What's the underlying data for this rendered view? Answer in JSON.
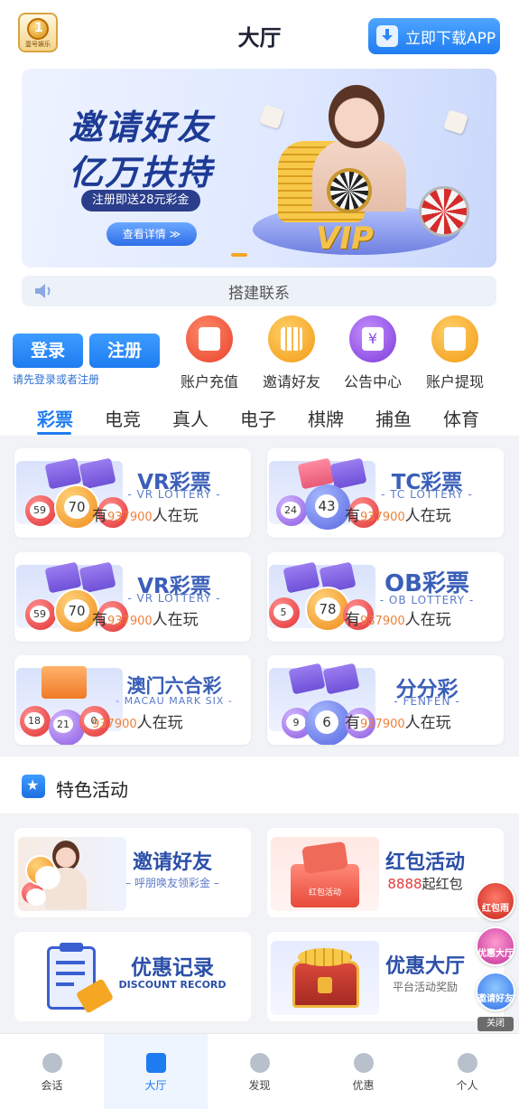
{
  "header": {
    "logo_text": "壹号娱乐",
    "title": "大厅",
    "download_label": "立即下载APP"
  },
  "banner": {
    "headline1": "邀请好友",
    "headline2": "亿万扶持",
    "subline": "注册即送28元彩金",
    "detail_label": "查看详情 ≫",
    "vip_text": "VIP"
  },
  "notice": {
    "text": "搭建联系"
  },
  "auth": {
    "login_label": "登录",
    "register_label": "注册",
    "hint": "请先登录或者注册"
  },
  "quick_actions": [
    {
      "label": "账户充值",
      "icon": "recharge-icon",
      "color": "#f0543c"
    },
    {
      "label": "邀请好友",
      "icon": "qrcode-icon",
      "color": "#f5a623"
    },
    {
      "label": "公告中心",
      "icon": "notice-icon",
      "color": "#8a4fe0"
    },
    {
      "label": "账户提现",
      "icon": "withdraw-icon",
      "color": "#f5a623"
    }
  ],
  "tabs": [
    "彩票",
    "电竞",
    "真人",
    "电子",
    "棋牌",
    "捕鱼",
    "体育"
  ],
  "active_tab": "彩票",
  "games": [
    {
      "title": "VR彩票",
      "subtitle": "- VR LOTTERY -",
      "play_prefix": "有",
      "players": "937900",
      "play_suffix": "人在玩",
      "ball": "70"
    },
    {
      "title": "TC彩票",
      "subtitle": "- TC LOTTERY -",
      "play_prefix": "有",
      "players": "937900",
      "play_suffix": "人在玩",
      "ball": "43"
    },
    {
      "title": "VR彩票",
      "subtitle": "- VR LOTTERY -",
      "play_prefix": "有",
      "players": "937900",
      "play_suffix": "人在玩",
      "ball": "70"
    },
    {
      "title": "OB彩票",
      "subtitle": "- OB LOTTERY -",
      "play_prefix": "有",
      "players": "937900",
      "play_suffix": "人在玩",
      "ball": "78"
    },
    {
      "title": "澳门六合彩",
      "subtitle": "- MACAU MARK SIX -",
      "play_prefix": "有",
      "players": "937900",
      "play_suffix": "人在玩",
      "ball": "21"
    },
    {
      "title": "分分彩",
      "subtitle": "- FENFEN -",
      "play_prefix": "有",
      "players": "937900",
      "play_suffix": "人在玩",
      "ball": "6"
    }
  ],
  "activities_section": {
    "title": "特色活动"
  },
  "activities": [
    {
      "title": "邀请好友",
      "subtitle": "– 呼朋唤友领彩金 –"
    },
    {
      "title": "红包活动",
      "amount": "8888",
      "suffix": "起红包",
      "badge": "红包活动"
    },
    {
      "title": "优惠记录",
      "subtitle": "DISCOUNT RECORD"
    },
    {
      "title": "优惠大厅",
      "subtitle": "平台活动奖励"
    }
  ],
  "float_ads": [
    {
      "label": "红包雨"
    },
    {
      "label": "优惠大厅"
    },
    {
      "label": "邀请好友"
    }
  ],
  "float_close": "关闭",
  "bottom_nav": [
    {
      "label": "会话",
      "icon": "chat-icon"
    },
    {
      "label": "大厅",
      "icon": "home-icon"
    },
    {
      "label": "发现",
      "icon": "compass-icon"
    },
    {
      "label": "优惠",
      "icon": "coupon-icon"
    },
    {
      "label": "个人",
      "icon": "user-icon"
    }
  ]
}
